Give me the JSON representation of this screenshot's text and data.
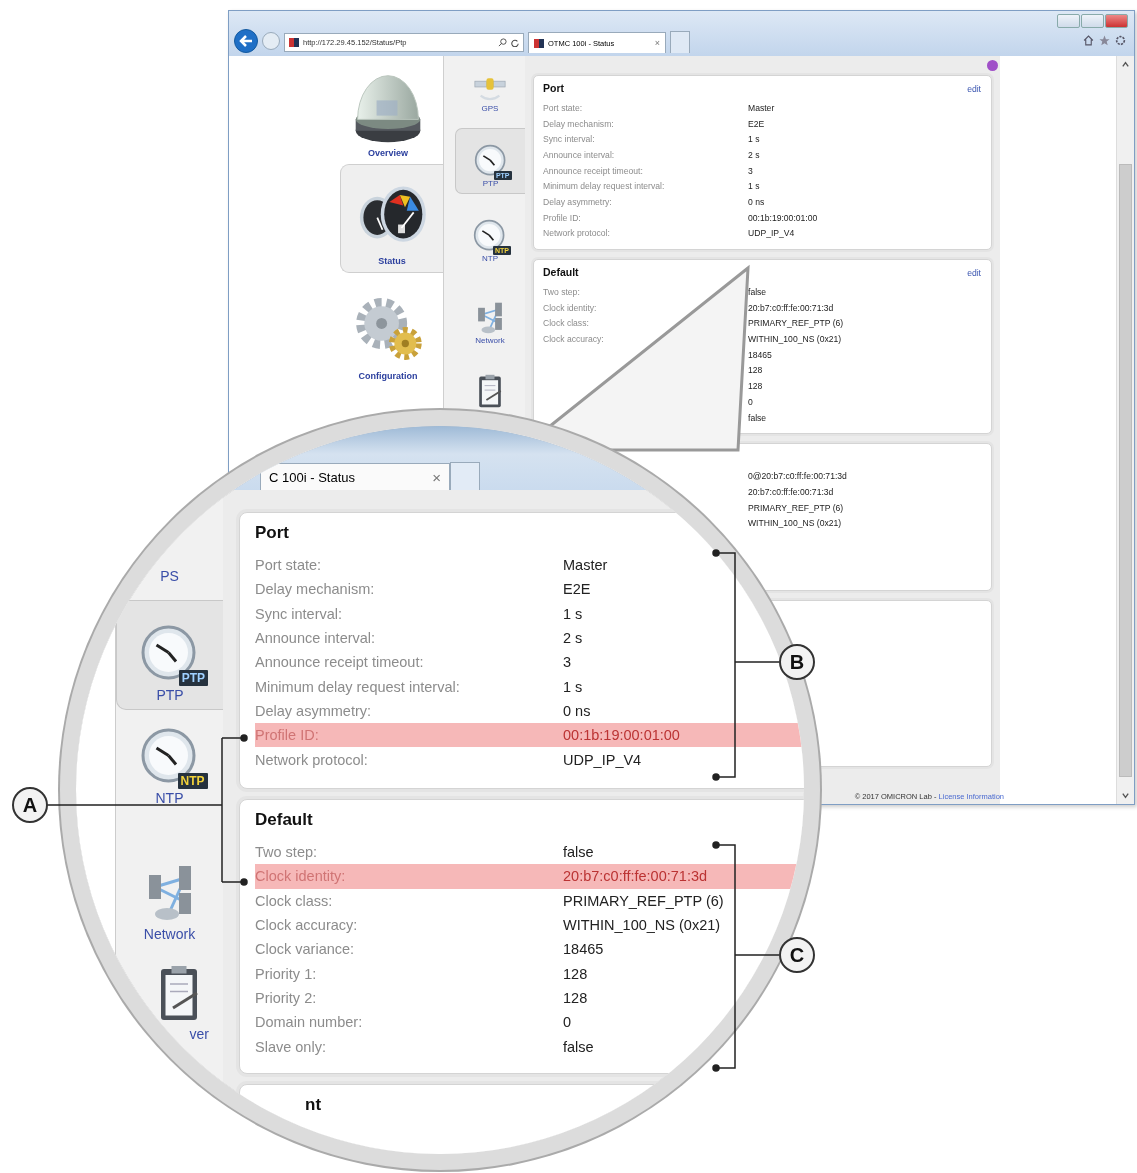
{
  "browser": {
    "address": "http://172.29.45.152/Status/Ptp",
    "tab": {
      "title": "OTMC 100i - Status",
      "close": "×"
    }
  },
  "nav": [
    {
      "label": "Overview",
      "selected": false
    },
    {
      "label": "Status",
      "selected": true
    },
    {
      "label": "Configuration",
      "selected": false
    }
  ],
  "subnav": [
    {
      "label": "GPS",
      "selected": false
    },
    {
      "label": "PTP",
      "badge": "PTP",
      "selected": true
    },
    {
      "label": "NTP",
      "badge": "NTP",
      "selected": false
    },
    {
      "label": "Network",
      "selected": false
    },
    {
      "selected": false
    }
  ],
  "cards": [
    {
      "title": "Port",
      "action": "edit",
      "rows": [
        {
          "label": "Port state:",
          "value": "Master"
        },
        {
          "label": "Delay mechanism:",
          "value": "E2E"
        },
        {
          "label": "Sync interval:",
          "value": "1 s"
        },
        {
          "label": "Announce interval:",
          "value": "2 s"
        },
        {
          "label": "Announce receipt timeout:",
          "value": "3"
        },
        {
          "label": "Minimum delay request interval:",
          "value": "1 s"
        },
        {
          "label": "Delay asymmetry:",
          "value": "0 ns"
        },
        {
          "label": "Profile ID:",
          "value": "00:1b:19:00:01:00"
        },
        {
          "label": "Network protocol:",
          "value": "UDP_IP_V4"
        }
      ]
    },
    {
      "title": "Default",
      "action": "edit",
      "rows": [
        {
          "label": "Two step:",
          "value": "false"
        },
        {
          "label": "Clock identity:",
          "value": "20:b7:c0:ff:fe:00:71:3d"
        },
        {
          "label": "Clock class:",
          "value": "PRIMARY_REF_PTP (6)"
        },
        {
          "label": "Clock accuracy:",
          "value": "WITHIN_100_NS (0x21)"
        },
        {
          "value": "18465"
        },
        {
          "value": "128"
        },
        {
          "value": "128"
        },
        {
          "value": "0"
        },
        {
          "value": "false"
        }
      ]
    },
    {
      "rows": [
        {
          "value": "0@20:b7:c0:ff:fe:00:71:3d"
        },
        {
          "value": "20:b7:c0:ff:fe:00:71:3d"
        },
        {
          "value": "PRIMARY_REF_PTP (6)"
        },
        {
          "value": "WITHIN_100_NS (0x21)"
        }
      ]
    }
  ],
  "footer": {
    "copyright": "© 2017 OMICRON Lab -",
    "link": "License Information"
  },
  "magnifier": {
    "tab": {
      "title": "C 100i - Status",
      "close": "×"
    },
    "subnav": [
      {
        "label": "PS",
        "selected": false
      },
      {
        "label": "PTP",
        "badge": "PTP",
        "selected": true
      },
      {
        "label": "NTP",
        "badge": "NTP",
        "selected": false
      },
      {
        "label": "Network",
        "selected": false
      },
      {
        "label": "ver",
        "selected": false
      }
    ],
    "cards": [
      {
        "title": "Port",
        "rows": [
          {
            "label": "Port state:",
            "value": "Master",
            "highlighted": false
          },
          {
            "label": "Delay mechanism:",
            "value": "E2E",
            "highlighted": false
          },
          {
            "label": "Sync interval:",
            "value": "1 s",
            "highlighted": false
          },
          {
            "label": "Announce interval:",
            "value": "2 s",
            "highlighted": false
          },
          {
            "label": "Announce receipt timeout:",
            "value": "3",
            "highlighted": false
          },
          {
            "label": "Minimum delay request interval:",
            "value": "1 s",
            "highlighted": false
          },
          {
            "label": "Delay asymmetry:",
            "value": "0 ns",
            "highlighted": false
          },
          {
            "label": "Profile ID:",
            "value": "00:1b:19:00:01:00",
            "highlighted": true
          },
          {
            "label": "Network protocol:",
            "value": "UDP_IP_V4",
            "highlighted": false
          }
        ]
      },
      {
        "title": "Default",
        "rows": [
          {
            "label": "Two step:",
            "value": "false",
            "highlighted": false
          },
          {
            "label": "Clock identity:",
            "value": "20:b7:c0:ff:fe:00:71:3d",
            "highlighted": true
          },
          {
            "label": "Clock class:",
            "value": "PRIMARY_REF_PTP (6)",
            "highlighted": false
          },
          {
            "label": "Clock accuracy:",
            "value": "WITHIN_100_NS (0x21)",
            "highlighted": false
          },
          {
            "label": "Clock variance:",
            "value": "18465",
            "highlighted": false
          },
          {
            "label": "Priority 1:",
            "value": "128",
            "highlighted": false
          },
          {
            "label": "Priority 2:",
            "value": "128",
            "highlighted": false
          },
          {
            "label": "Domain number:",
            "value": "0",
            "highlighted": false
          },
          {
            "label": "Slave only:",
            "value": "false",
            "highlighted": false
          }
        ]
      },
      {
        "title": "nt"
      }
    ]
  },
  "callouts": [
    {
      "letter": "A"
    },
    {
      "letter": "B"
    },
    {
      "letter": "C"
    }
  ]
}
